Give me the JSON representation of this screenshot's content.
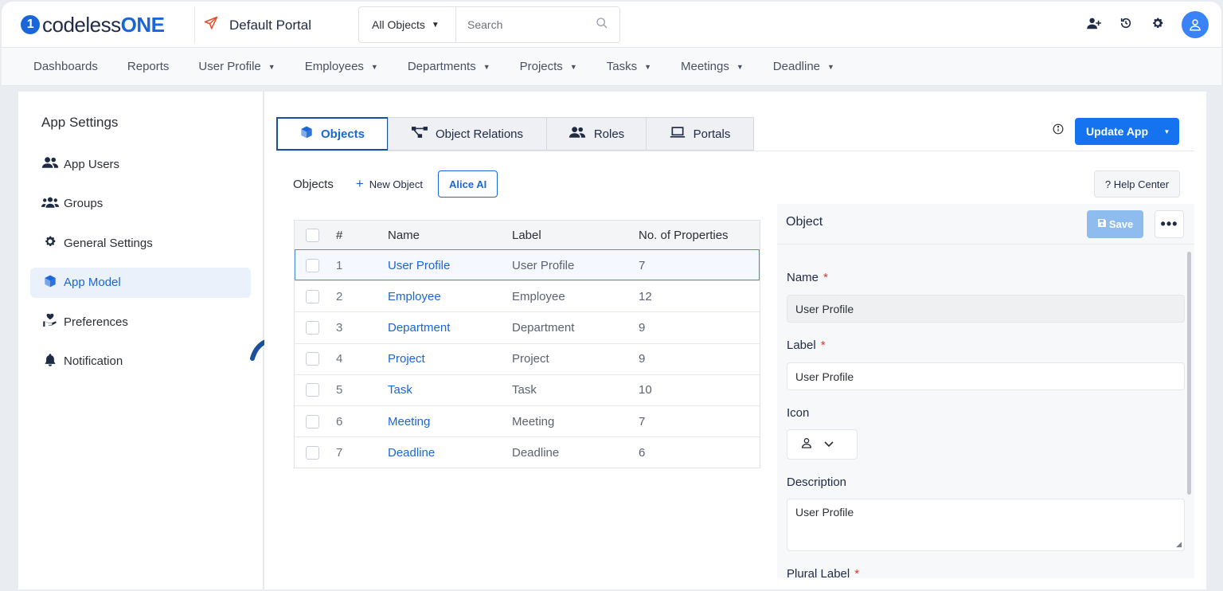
{
  "header": {
    "logo_prefix": "codeless",
    "logo_suffix": "ONE",
    "logo_mark": "1",
    "portal_name": "Default Portal",
    "search_scope": "All Objects",
    "search_placeholder": "Search",
    "icons": [
      "paper-plane-icon",
      "search-icon",
      "add-user-icon",
      "history-icon",
      "gear-icon",
      "user-avatar-icon"
    ]
  },
  "nav": {
    "items": [
      {
        "label": "Dashboards",
        "dropdown": false
      },
      {
        "label": "Reports",
        "dropdown": false
      },
      {
        "label": "User Profile",
        "dropdown": true
      },
      {
        "label": "Employees",
        "dropdown": true
      },
      {
        "label": "Departments",
        "dropdown": true
      },
      {
        "label": "Projects",
        "dropdown": true
      },
      {
        "label": "Tasks",
        "dropdown": true
      },
      {
        "label": "Meetings",
        "dropdown": true
      },
      {
        "label": "Deadline",
        "dropdown": true
      }
    ]
  },
  "sidebar": {
    "title": "App Settings",
    "items": [
      {
        "label": "App Users",
        "icon": "users-icon"
      },
      {
        "label": "Groups",
        "icon": "groups-icon"
      },
      {
        "label": "General Settings",
        "icon": "gear-icon"
      },
      {
        "label": "App Model",
        "icon": "cube-icon",
        "active": true
      },
      {
        "label": "Preferences",
        "icon": "hand-heart-icon"
      },
      {
        "label": "Notification",
        "icon": "bell-icon"
      }
    ]
  },
  "tabs": {
    "items": [
      {
        "label": "Objects",
        "icon": "cube-icon",
        "active": true
      },
      {
        "label": "Object Relations",
        "icon": "relations-icon"
      },
      {
        "label": "Roles",
        "icon": "users-icon"
      },
      {
        "label": "Portals",
        "icon": "laptop-icon"
      }
    ],
    "update_label": "Update App"
  },
  "objects_bar": {
    "title": "Objects",
    "new_object": "New Object",
    "alice": "Alice AI",
    "help": "? Help Center"
  },
  "table": {
    "columns": [
      "#",
      "Name",
      "Label",
      "No. of Properties"
    ],
    "rows": [
      {
        "num": "1",
        "name": "User Profile",
        "label": "User Profile",
        "props": "7",
        "selected": true
      },
      {
        "num": "2",
        "name": "Employee",
        "label": "Employee",
        "props": "12"
      },
      {
        "num": "3",
        "name": "Department",
        "label": "Department",
        "props": "9"
      },
      {
        "num": "4",
        "name": "Project",
        "label": "Project",
        "props": "9"
      },
      {
        "num": "5",
        "name": "Task",
        "label": "Task",
        "props": "10"
      },
      {
        "num": "6",
        "name": "Meeting",
        "label": "Meeting",
        "props": "7"
      },
      {
        "num": "7",
        "name": "Deadline",
        "label": "Deadline",
        "props": "6"
      }
    ]
  },
  "object_panel": {
    "title": "Object",
    "save_label": "Save",
    "more": "•••",
    "name_label": "Name",
    "name_value": "User Profile",
    "label_label": "Label",
    "label_value": "User Profile",
    "icon_label": "Icon",
    "description_label": "Description",
    "description_value": "User Profile",
    "plural_label": "Plural Label",
    "required_mark": "*"
  },
  "colors": {
    "brand": "#1a66d9",
    "primary_button": "#1673f0",
    "save_disabled": "#8fbcef",
    "required": "#e0342c",
    "active_tab_border": "#1a4f9c"
  }
}
